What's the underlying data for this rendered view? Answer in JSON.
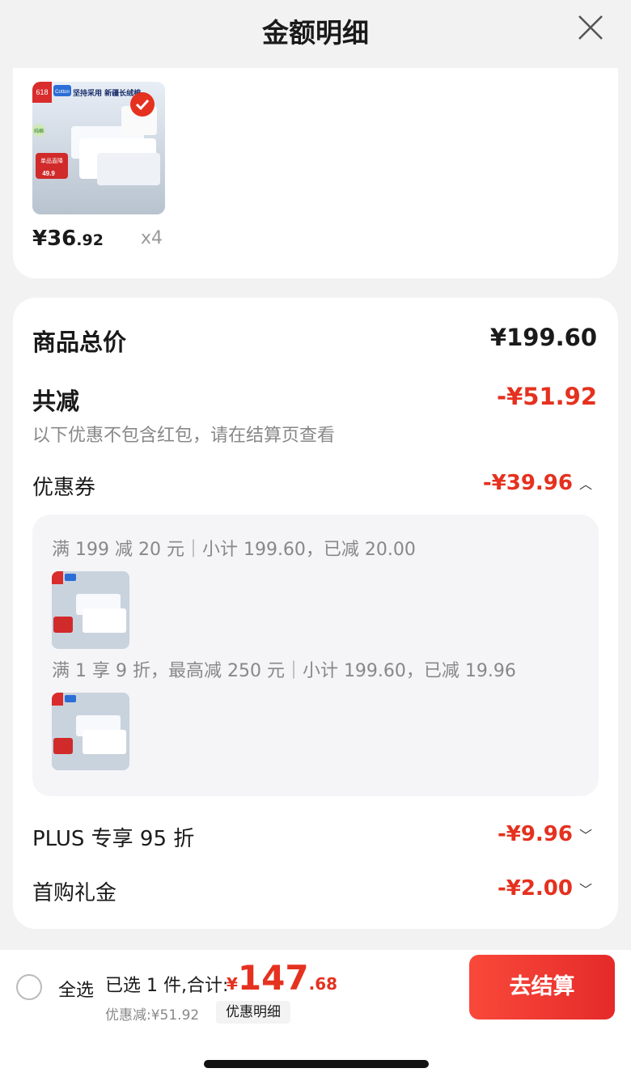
{
  "header": {
    "title": "金额明细",
    "close_icon": "close-icon"
  },
  "product": {
    "price_int": "¥36",
    "price_dec": ".92",
    "qty": "x4",
    "image_text": {
      "badge": "618",
      "brand": "Cotton",
      "headline": "坚持采用 新疆长绒棉",
      "tag": "纯棉",
      "promo": "单品直降",
      "promo_price": "49.9"
    }
  },
  "summary": {
    "total_label": "商品总价",
    "total_value": "¥199.60",
    "reduce_label": "共减",
    "reduce_value": "-¥51.92",
    "note": "以下优惠不包含红包，请在结算页查看"
  },
  "coupons": {
    "label": "优惠券",
    "value": "-¥39.96",
    "chevron": "chevron-up-icon",
    "items": [
      {
        "text": "满 199 减 20 元｜小计 199.60，已减 20.00"
      },
      {
        "text": "满 1 享 9 折，最高减 250 元｜小计 199.60，已减 19.96"
      }
    ]
  },
  "plus": {
    "label": "PLUS 专享 95 折",
    "value": "-¥9.96",
    "chevron": "chevron-down-icon"
  },
  "firstbuy": {
    "label": "首购礼金",
    "value": "-¥2.00",
    "chevron": "chevron-down-icon"
  },
  "bottom_bar": {
    "select_all": "全选",
    "selected_text": "已选 1 件,合计:",
    "total_currency": "¥",
    "total_int": "147",
    "total_dec": ".68",
    "discount_text": "优惠减:¥51.92",
    "detail_button": "优惠明细",
    "checkout_button": "去结算"
  },
  "colors": {
    "accent_red": "#e5311f",
    "checkout_red": "#f23b30"
  }
}
